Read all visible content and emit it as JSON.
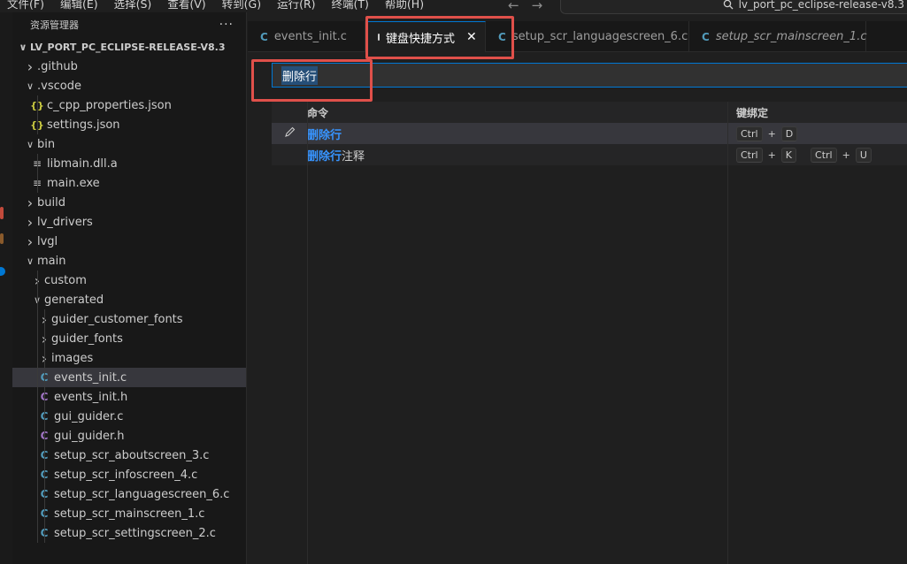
{
  "menubar": {
    "items": [
      "文件(F)",
      "编辑(E)",
      "选择(S)",
      "查看(V)",
      "转到(G)",
      "运行(R)",
      "终端(T)",
      "帮助(H)"
    ],
    "search_text": "lv_port_pc_eclipse-release-v8.3"
  },
  "sidebar": {
    "title": "资源管理器",
    "more": "···",
    "project": "LV_PORT_PC_ECLIPSE-RELEASE-V8.3",
    "tree": [
      {
        "label": ".github",
        "type": "folder",
        "expanded": false,
        "depth": 1
      },
      {
        "label": ".vscode",
        "type": "folder",
        "expanded": true,
        "depth": 1
      },
      {
        "label": "c_cpp_properties.json",
        "type": "json",
        "depth": 2
      },
      {
        "label": "settings.json",
        "type": "json",
        "depth": 2
      },
      {
        "label": "bin",
        "type": "folder",
        "expanded": true,
        "depth": 1
      },
      {
        "label": "libmain.dll.a",
        "type": "file",
        "depth": 2
      },
      {
        "label": "main.exe",
        "type": "file",
        "depth": 2
      },
      {
        "label": "build",
        "type": "folder",
        "expanded": false,
        "depth": 1
      },
      {
        "label": "lv_drivers",
        "type": "folder",
        "expanded": false,
        "depth": 1
      },
      {
        "label": "lvgl",
        "type": "folder",
        "expanded": false,
        "depth": 1
      },
      {
        "label": "main",
        "type": "folder",
        "expanded": true,
        "depth": 1
      },
      {
        "label": "custom",
        "type": "folder",
        "expanded": false,
        "depth": 2
      },
      {
        "label": "generated",
        "type": "folder",
        "expanded": true,
        "depth": 2
      },
      {
        "label": "guider_customer_fonts",
        "type": "folder",
        "expanded": false,
        "depth": 3
      },
      {
        "label": "guider_fonts",
        "type": "folder",
        "expanded": false,
        "depth": 3
      },
      {
        "label": "images",
        "type": "folder",
        "expanded": false,
        "depth": 3
      },
      {
        "label": "events_init.c",
        "type": "c",
        "depth": 3,
        "selected": true
      },
      {
        "label": "events_init.h",
        "type": "h",
        "depth": 3
      },
      {
        "label": "gui_guider.c",
        "type": "c",
        "depth": 3
      },
      {
        "label": "gui_guider.h",
        "type": "h",
        "depth": 3
      },
      {
        "label": "setup_scr_aboutscreen_3.c",
        "type": "c",
        "depth": 3
      },
      {
        "label": "setup_scr_infoscreen_4.c",
        "type": "c",
        "depth": 3
      },
      {
        "label": "setup_scr_languagescreen_6.c",
        "type": "c",
        "depth": 3
      },
      {
        "label": "setup_scr_mainscreen_1.c",
        "type": "c",
        "depth": 3
      },
      {
        "label": "setup_scr_settingscreen_2.c",
        "type": "c",
        "depth": 3
      }
    ]
  },
  "tabs": [
    {
      "label": "events_init.c",
      "icon": "c",
      "active": false,
      "italic": false
    },
    {
      "label": "键盘快捷方式",
      "icon": "keyboard",
      "active": true,
      "italic": false
    },
    {
      "label": "setup_scr_languagescreen_6.c",
      "icon": "c",
      "active": false,
      "italic": false
    },
    {
      "label": "setup_scr_mainscreen_1.c",
      "icon": "c",
      "active": false,
      "italic": true
    }
  ],
  "keybindings": {
    "search_value": "删除行",
    "headers": {
      "command": "命令",
      "keybinding": "键绑定"
    },
    "rows": [
      {
        "cmd_highlight": "删除行",
        "cmd_rest": "",
        "chords": [
          [
            "Ctrl",
            "D"
          ]
        ]
      },
      {
        "cmd_highlight": "删除行",
        "cmd_rest": "注释",
        "chords": [
          [
            "Ctrl",
            "K"
          ],
          [
            "Ctrl",
            "U"
          ]
        ]
      }
    ]
  },
  "colors": {
    "accent": "#0078d4",
    "highlight": "#3794ff",
    "annotation": "#e0504a"
  }
}
